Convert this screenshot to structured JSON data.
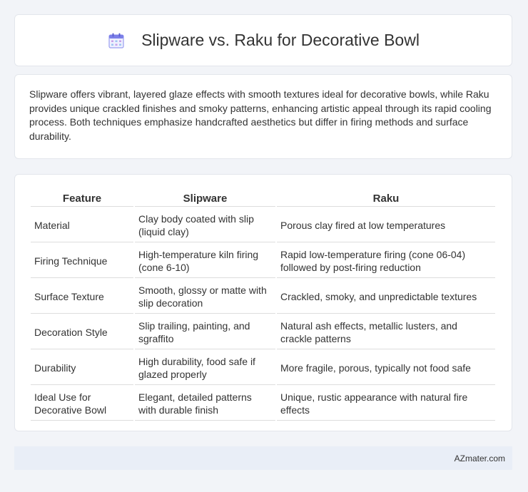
{
  "header": {
    "icon": "calendar-icon",
    "title": "Slipware vs. Raku for Decorative Bowl"
  },
  "summary": {
    "text": "Slipware offers vibrant, layered glaze effects with smooth textures ideal for decorative bowls, while Raku provides unique crackled finishes and smoky patterns, enhancing artistic appeal through its rapid cooling process. Both techniques emphasize handcrafted aesthetics but differ in firing methods and surface durability."
  },
  "table": {
    "headers": [
      "Feature",
      "Slipware",
      "Raku"
    ],
    "rows": [
      [
        "Material",
        "Clay body coated with slip (liquid clay)",
        "Porous clay fired at low temperatures"
      ],
      [
        "Firing Technique",
        "High-temperature kiln firing (cone 6-10)",
        "Rapid low-temperature firing (cone 06-04) followed by post-firing reduction"
      ],
      [
        "Surface Texture",
        "Smooth, glossy or matte with slip decoration",
        "Crackled, smoky, and unpredictable textures"
      ],
      [
        "Decoration Style",
        "Slip trailing, painting, and sgraffito",
        "Natural ash effects, metallic lusters, and crackle patterns"
      ],
      [
        "Durability",
        "High durability, food safe if glazed properly",
        "More fragile, porous, typically not food safe"
      ],
      [
        "Ideal Use for Decorative Bowl",
        "Elegant, detailed patterns with durable finish",
        "Unique, rustic appearance with natural fire effects"
      ]
    ]
  },
  "footer": {
    "brand": "AZmater.com"
  },
  "colors": {
    "background": "#f2f4f8",
    "footer_bg": "#e9eef7",
    "icon_accent": "#7b7fe8"
  }
}
